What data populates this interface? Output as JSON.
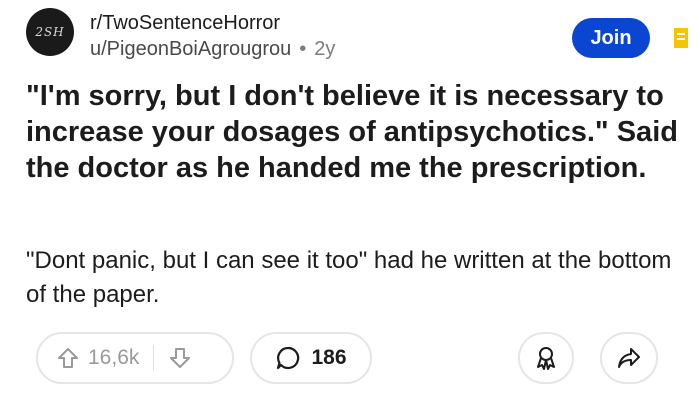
{
  "post": {
    "avatar_text": "2SH",
    "subreddit": "r/TwoSentenceHorror",
    "username": "u/PigeonBoiAgrougrou",
    "separator": "•",
    "age": "2y",
    "join_label": "Join",
    "title": "\"I'm sorry, but I don't believe it is necessary to increase your dosages of antipsychotics.\" Said the doctor as he handed me the prescription.",
    "body": "\"Dont panic, but I can see it too\" had he written at the bottom of the paper."
  },
  "actions": {
    "upvote_count": "16,6k",
    "comment_count": "186"
  },
  "icons": [
    "upvote-icon",
    "downvote-icon",
    "comment-icon",
    "award-icon",
    "share-icon",
    "bookmark-flag-icon"
  ],
  "colors": {
    "join_button": "#0a46d1",
    "flag": "#f5c400",
    "text": "#1c1c1c",
    "muted": "#7c7c7c",
    "pill_border": "#e5e5e5"
  }
}
